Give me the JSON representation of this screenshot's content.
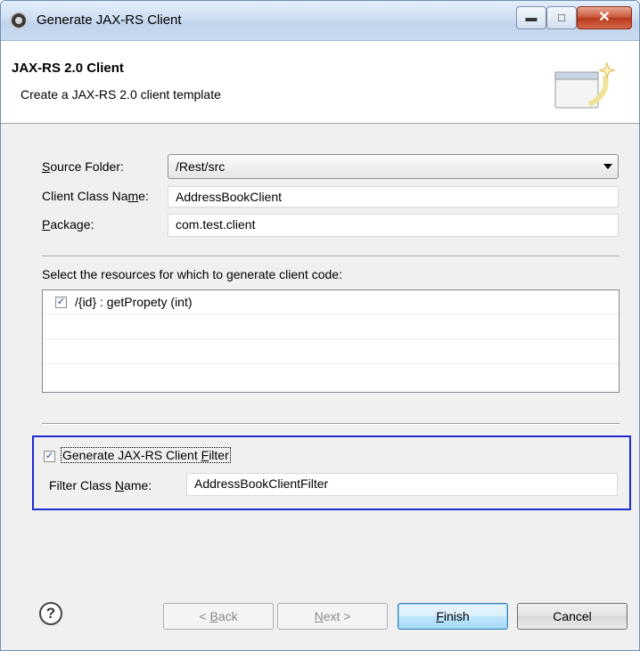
{
  "window": {
    "title": "Generate JAX-RS Client"
  },
  "header": {
    "title": "JAX-RS 2.0 Client",
    "description": "Create a JAX-RS 2.0 client template"
  },
  "form": {
    "source_folder": {
      "label_u": "S",
      "label_rest": "ource Folder:",
      "value": "/Rest/src"
    },
    "client_class": {
      "label_pre": "Client Class Na",
      "label_u": "m",
      "label_rest": "e:",
      "value": "AddressBookClient"
    },
    "package": {
      "label_u": "P",
      "label_rest": "ackage:",
      "value": "com.test.client"
    }
  },
  "resources": {
    "label": "Select the resources for which to generate client code:",
    "items": [
      {
        "label": "/{id} : getPropety (int)",
        "checked": true
      }
    ]
  },
  "filter": {
    "checkbox_pre": "Generate JAX-RS Client ",
    "checkbox_u": "F",
    "checkbox_rest": "ilter",
    "checked": true,
    "class_label_pre": "Filter Class ",
    "class_label_u": "N",
    "class_label_rest": "ame:",
    "class_value": "AddressBookClientFilter"
  },
  "buttons": {
    "back": {
      "prefix": "< ",
      "u": "B",
      "rest": "ack"
    },
    "next": {
      "u": "N",
      "rest": "ext >"
    },
    "finish": {
      "u": "F",
      "rest": "inish"
    },
    "cancel": "Cancel"
  }
}
